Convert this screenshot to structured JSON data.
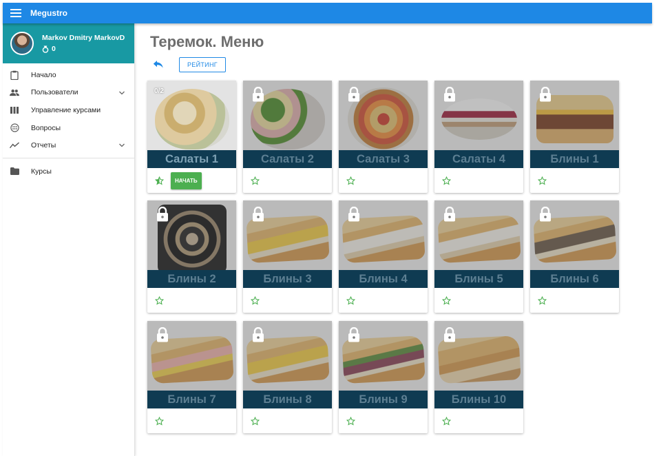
{
  "app": {
    "title": "Megustro"
  },
  "user": {
    "name": "Markov Dmitry MarkovD",
    "points": "0"
  },
  "sidebar": {
    "items": [
      {
        "label": "Начало",
        "icon": "clipboard-icon",
        "expandable": false
      },
      {
        "label": "Пользователи",
        "icon": "people-icon",
        "expandable": true
      },
      {
        "label": "Управление курсами",
        "icon": "columns-icon",
        "expandable": false
      },
      {
        "label": "Вопросы",
        "icon": "question-icon",
        "expandable": false
      },
      {
        "label": "Отчеты",
        "icon": "chart-line-icon",
        "expandable": true
      }
    ],
    "bottom_items": [
      {
        "label": "Курсы",
        "icon": "folder-icon"
      }
    ]
  },
  "page": {
    "title": "Теремок. Меню",
    "rating_button": "РЕЙТИНГ",
    "start_button": "НАЧАТЬ",
    "progress": "0/2"
  },
  "courses": [
    {
      "label": "Салаты 1",
      "locked": false
    },
    {
      "label": "Салаты 2",
      "locked": true
    },
    {
      "label": "Салаты 3",
      "locked": true
    },
    {
      "label": "Салаты 4",
      "locked": true
    },
    {
      "label": "Блины 1",
      "locked": true
    },
    {
      "label": "Блины 2",
      "locked": true
    },
    {
      "label": "Блины 3",
      "locked": true
    },
    {
      "label": "Блины 4",
      "locked": true
    },
    {
      "label": "Блины 5",
      "locked": true
    },
    {
      "label": "Блины 6",
      "locked": true
    },
    {
      "label": "Блины 7",
      "locked": true
    },
    {
      "label": "Блины 8",
      "locked": true
    },
    {
      "label": "Блины 9",
      "locked": true
    },
    {
      "label": "Блины 10",
      "locked": true
    }
  ],
  "colors": {
    "topbar": "#1e88e5",
    "profile": "#1899a3",
    "banner": "#0f3b52",
    "start_button": "#4caf50",
    "star": "#4caf50"
  }
}
